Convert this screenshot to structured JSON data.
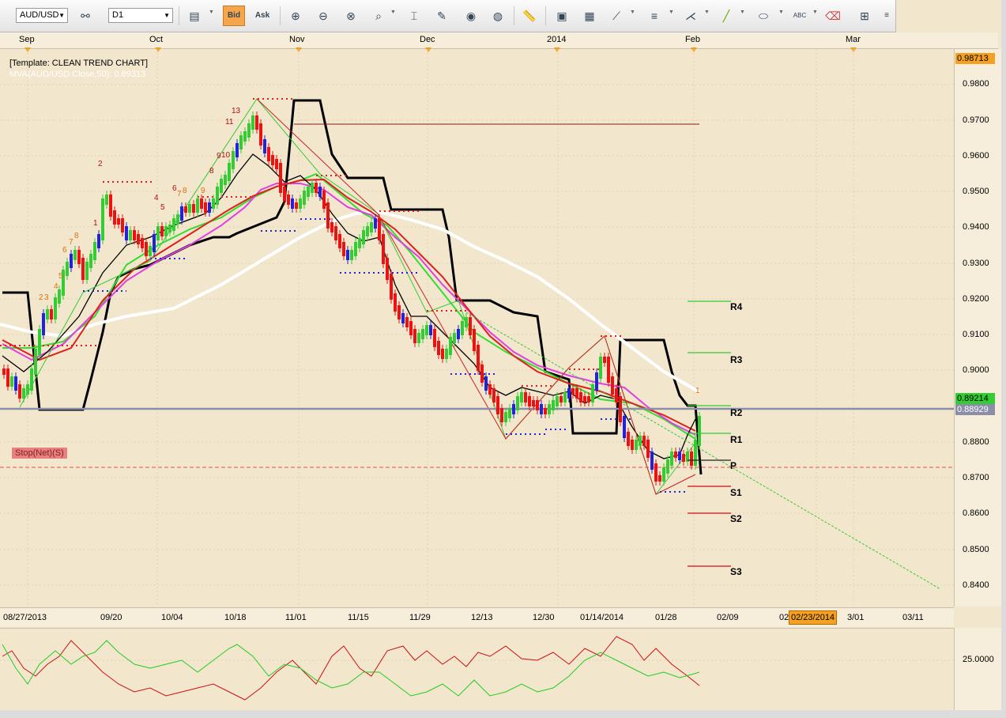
{
  "toolbar": {
    "symbol": "AUD/USD",
    "timeframe": "D1",
    "bid_label": "Bid",
    "ask_label": "Ask"
  },
  "chart": {
    "template_label": "[Template: CLEAN TREND CHART]",
    "ma_label": "MVA(AUD/USD.Close,50): 0.89313",
    "stop_label": "Stop(Net)(S)"
  },
  "months": [
    {
      "label": "Sep"
    },
    {
      "label": "Oct"
    },
    {
      "label": "Nov"
    },
    {
      "label": "Dec"
    },
    {
      "label": "2014"
    },
    {
      "label": "Feb"
    },
    {
      "label": "Mar"
    }
  ],
  "price_ticks": [
    "0.9800",
    "0.9700",
    "0.9600",
    "0.9500",
    "0.9400",
    "0.9300",
    "0.9200",
    "0.9100",
    "0.9000",
    "0.8800",
    "0.8700",
    "0.8600",
    "0.8500",
    "0.8400"
  ],
  "price_highlights": {
    "top": "0.98713",
    "current_bid": "0.89214",
    "line_level": "0.88929"
  },
  "pivots": [
    "R4",
    "R3",
    "R2",
    "R1",
    "P",
    "S1",
    "S2",
    "S3"
  ],
  "dates": [
    "08/27/2013",
    "09/20",
    "10/04",
    "10/18",
    "11/01",
    "11/15",
    "11/29",
    "12/13",
    "12/30",
    "01/14/2014",
    "01/28",
    "02/09",
    "02",
    "02/23/2014",
    "3/01",
    "03/11"
  ],
  "oscillator": {
    "level_label": "25.0000"
  },
  "counts": {
    "c1": "2",
    "c2": "3",
    "c3": "1",
    "c4": "4",
    "c5": "5",
    "c6": "6",
    "c7": "7",
    "c8": "8",
    "c9": "9",
    "c10": "10",
    "c11": "11",
    "c12": "13",
    "c13": "1"
  },
  "colors": {
    "background": "#f2e6cc",
    "bull_candle": "#33cc33",
    "bear_candle": "#ee1111",
    "neutral_candle": "#2222dd",
    "ma_white": "#ffffff",
    "ma_magenta": "#e040e0",
    "ma_red": "#dd2020",
    "ma_green": "#33dd33",
    "channel_black": "#000000",
    "highlight_orange": "#f5a020"
  }
}
